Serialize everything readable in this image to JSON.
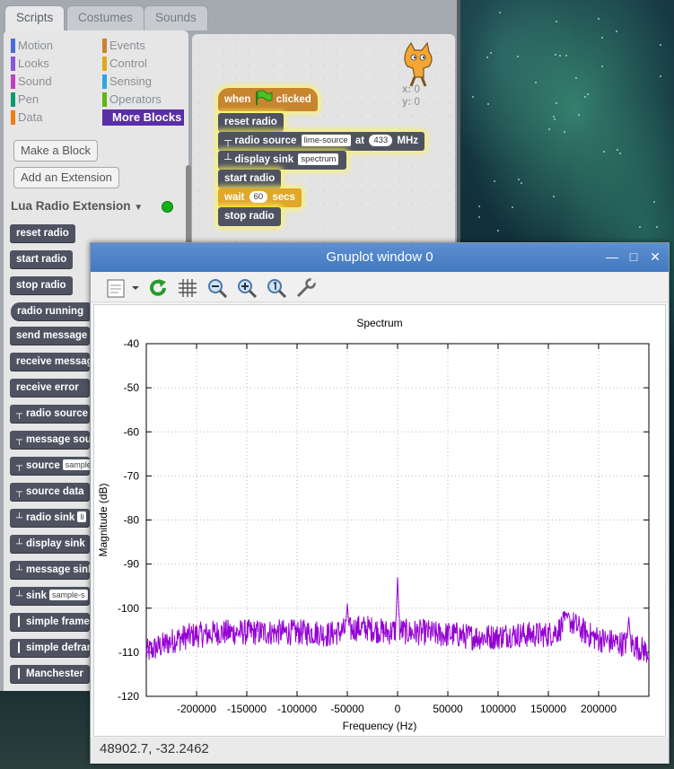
{
  "colors": {
    "motion": "#4a6cd4",
    "looks": "#8a55d7",
    "sound": "#bb42c3",
    "pen": "#0e9a6c",
    "data": "#ee7d16",
    "events": "#c88330",
    "control": "#e1a91a",
    "sensing": "#2ca5e2",
    "operators": "#5cb712",
    "more_blocks": "#632d99",
    "custom_block": "#4f5361",
    "series": "#9400d3",
    "titlebar": "#4a82c8"
  },
  "scratch": {
    "tabs": [
      "Scripts",
      "Costumes",
      "Sounds"
    ],
    "categories_left": [
      "Motion",
      "Looks",
      "Sound",
      "Pen",
      "Data"
    ],
    "categories_right": [
      "Events",
      "Control",
      "Sensing",
      "Operators",
      "More Blocks"
    ],
    "make_block": "Make a Block",
    "add_extension": "Add an Extension",
    "extension_title": "Lua Radio Extension",
    "extension_status": "connected",
    "palette_blocks": [
      {
        "label": "reset radio"
      },
      {
        "label": "start radio"
      },
      {
        "label": "stop radio"
      },
      {
        "label": "radio running"
      },
      {
        "label": "send message"
      },
      {
        "label": "receive message"
      },
      {
        "label": "receive error"
      },
      {
        "label": "radio source"
      },
      {
        "label": "message source"
      },
      {
        "label": "source",
        "slot": "sample"
      },
      {
        "label": "source data"
      },
      {
        "label": "radio sink",
        "slot": "li"
      },
      {
        "label": "display sink"
      },
      {
        "label": "message sink"
      },
      {
        "label": "sink",
        "slot": "sample-s"
      },
      {
        "label": "simple framer"
      },
      {
        "label": "simple deframer"
      },
      {
        "label": "Manchester"
      }
    ],
    "sprite": {
      "x_label": "x:",
      "x": "0",
      "y_label": "y:",
      "y": "0"
    },
    "script": {
      "hat_when": "when",
      "hat_clicked": "clicked",
      "reset": "reset radio",
      "radio_source": "radio source",
      "source_name": "lime-source",
      "at": "at",
      "freq": "433",
      "unit": "MHz",
      "display_sink": "display sink",
      "sink_name": "spectrum",
      "start": "start radio",
      "wait": "wait",
      "secs_value": "60",
      "secs": "secs",
      "stop": "stop radio"
    }
  },
  "gnuplot": {
    "title": "Gnuplot window 0",
    "status": "48902.7, -32.2462",
    "tools": [
      "export-icon",
      "replot-icon",
      "grid-icon",
      "zoom-out-icon",
      "zoom-in-icon",
      "zoom-fit-icon",
      "config-icon"
    ]
  },
  "chart_data": {
    "type": "line",
    "title": "Spectrum",
    "xlabel": "Frequency (Hz)",
    "ylabel": "Magnitude (dB)",
    "xlim": [
      -250000,
      250000
    ],
    "ylim": [
      -120,
      -40
    ],
    "xticks": [
      -200000,
      -150000,
      -100000,
      -50000,
      0,
      50000,
      100000,
      150000,
      200000
    ],
    "yticks": [
      -40,
      -50,
      -60,
      -70,
      -80,
      -90,
      -100,
      -110,
      -120
    ],
    "grid": true,
    "series": [
      {
        "color": "#9400d3",
        "x": [
          -250000,
          -240000,
          -230000,
          -220000,
          -210000,
          -200000,
          -190000,
          -180000,
          -170000,
          -160000,
          -150000,
          -140000,
          -130000,
          -120000,
          -110000,
          -100000,
          -90000,
          -80000,
          -70000,
          -60000,
          -52000,
          -50000,
          -48000,
          -40000,
          -30000,
          -20000,
          -10000,
          -2000,
          0,
          2000,
          10000,
          20000,
          30000,
          40000,
          50000,
          60000,
          70000,
          80000,
          90000,
          100000,
          110000,
          120000,
          130000,
          140000,
          150000,
          160000,
          168000,
          170000,
          172000,
          180000,
          190000,
          200000,
          210000,
          220000,
          228000,
          230000,
          232000,
          240000,
          250000
        ],
        "y": [
          -110,
          -109,
          -108,
          -107,
          -106.5,
          -106,
          -106,
          -105.5,
          -105.5,
          -105.5,
          -105.5,
          -105.5,
          -105.5,
          -105.5,
          -105.5,
          -105.5,
          -105.5,
          -105.5,
          -106,
          -105.5,
          -105,
          -99,
          -105,
          -104.5,
          -104.5,
          -105,
          -105.5,
          -105,
          -93,
          -105,
          -105.5,
          -105.5,
          -105.5,
          -106,
          -106,
          -106,
          -106.5,
          -106.5,
          -106.5,
          -106.5,
          -106,
          -106,
          -106,
          -106,
          -106,
          -105,
          -103,
          -101,
          -103,
          -104.5,
          -106,
          -107,
          -107.5,
          -108,
          -108,
          -102,
          -108,
          -109,
          -110
        ]
      }
    ]
  }
}
